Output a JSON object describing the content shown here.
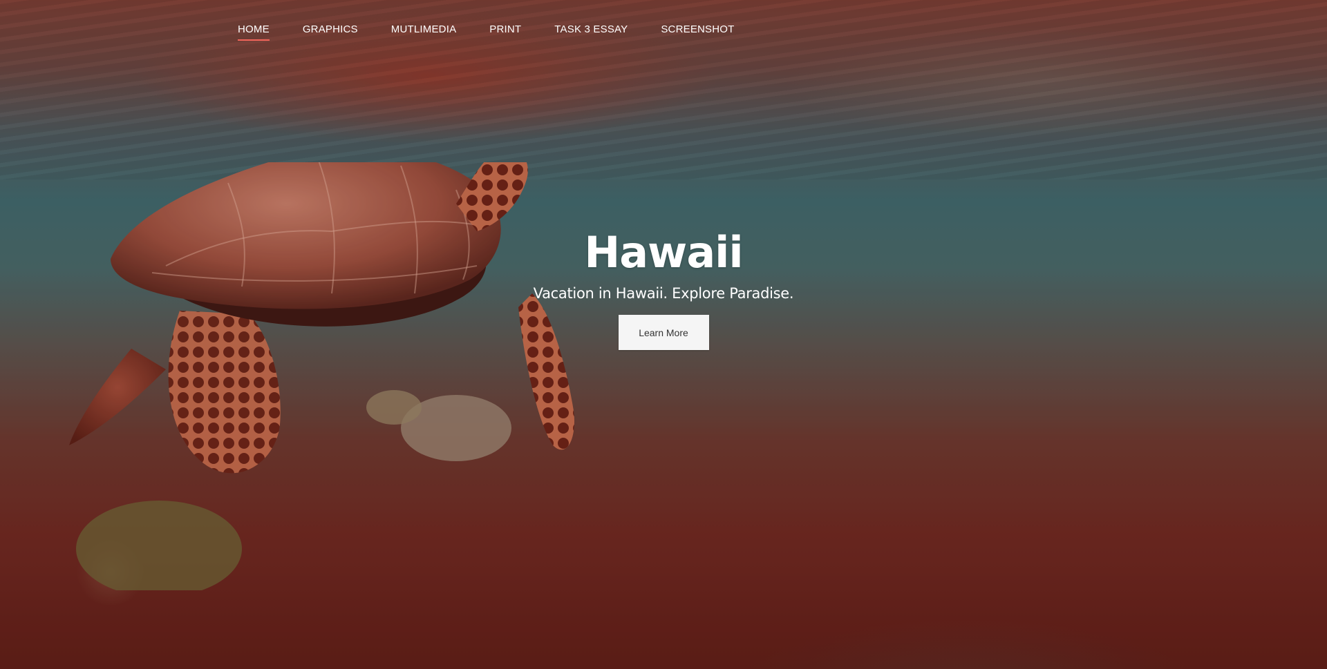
{
  "nav": {
    "items": [
      {
        "label": "HOME",
        "active": true
      },
      {
        "label": "GRAPHICS",
        "active": false
      },
      {
        "label": "MUTLIMEDIA",
        "active": false
      },
      {
        "label": "PRINT",
        "active": false
      },
      {
        "label": "TASK 3 ESSAY",
        "active": false
      },
      {
        "label": "SCREENSHOT",
        "active": false
      }
    ],
    "active_underline_color": "#f2655a"
  },
  "hero": {
    "title": "Hawaii",
    "subtitle": "Vacation in Hawaii. Explore Paradise.",
    "button_label": "Learn More",
    "background_image": "sea-turtle-underwater-photo"
  },
  "colors": {
    "text": "#ffffff",
    "button_bg": "#f5f5f5",
    "button_text": "#333333"
  }
}
